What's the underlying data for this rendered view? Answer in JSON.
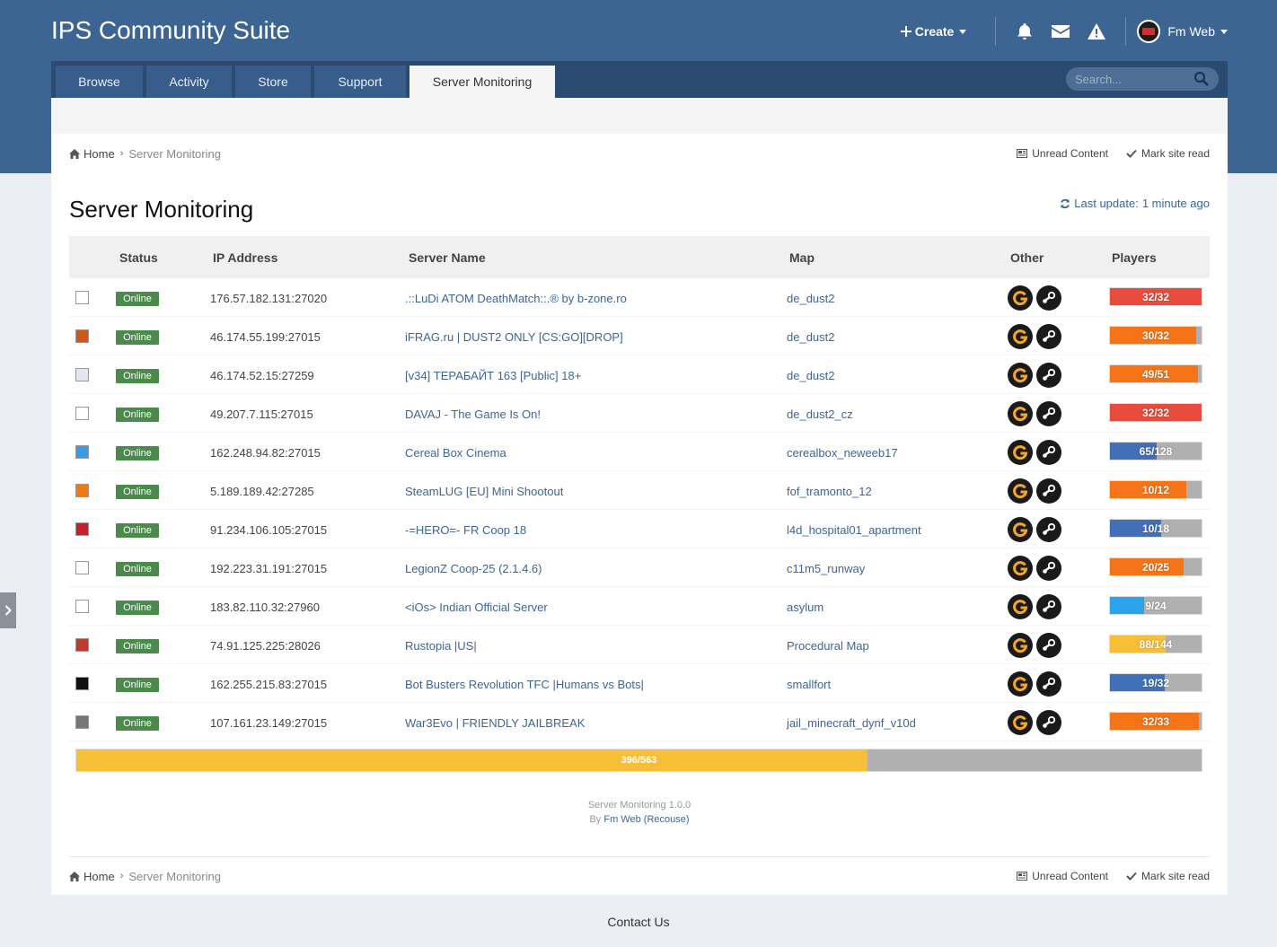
{
  "header": {
    "site_title": "IPS Community Suite",
    "create_label": "Create",
    "user_name": "Fm Web"
  },
  "nav": {
    "tabs": [
      "Browse",
      "Activity",
      "Store",
      "Support",
      "Server Monitoring"
    ],
    "active_tab": "Server Monitoring",
    "search_placeholder": "Search..."
  },
  "breadcrumb": {
    "home": "Home",
    "current": "Server Monitoring",
    "unread_content": "Unread Content",
    "mark_site_read": "Mark site read"
  },
  "page": {
    "title": "Server Monitoring",
    "last_update_label": "Last update:",
    "last_update_value": "1 minute ago"
  },
  "table": {
    "columns": [
      "Status",
      "IP Address",
      "Server Name",
      "Map",
      "Other",
      "Players"
    ],
    "rows": [
      {
        "game_icon": "cs-icon",
        "status": "Online",
        "ip": "176.57.182.131:27020",
        "name": ".::LuDi ATOM DeathMatch::.® by b-zone.ro",
        "map": "de_dust2",
        "players": "32/32",
        "fill": 1.0,
        "color": "#e74c3c"
      },
      {
        "game_icon": "csgo-icon",
        "status": "Online",
        "ip": "46.174.55.199:27015",
        "name": "iFRAG.ru | DUST2 ONLY [CS:GO][DROP]",
        "map": "de_dust2",
        "players": "30/32",
        "fill": 0.9375,
        "color": "#f57418"
      },
      {
        "game_icon": "cs-source-icon",
        "status": "Online",
        "ip": "46.174.52.15:27259",
        "name": "[v34] ТЕРАБАЙТ 163 [Public] 18+",
        "map": "de_dust2",
        "players": "49/51",
        "fill": 0.96,
        "color": "#f57418"
      },
      {
        "game_icon": "cs-icon",
        "status": "Online",
        "ip": "49.207.7.115:27015",
        "name": "DAVAJ - The Game Is On!",
        "map": "de_dust2_cz",
        "players": "32/32",
        "fill": 1.0,
        "color": "#e74c3c"
      },
      {
        "game_icon": "gmod-icon",
        "status": "Online",
        "ip": "162.248.94.82:27015",
        "name": "Cereal Box Cinema",
        "map": "cerealbox_neweeb17",
        "players": "65/128",
        "fill": 0.508,
        "color": "#4170b8"
      },
      {
        "game_icon": "half-life-icon",
        "status": "Online",
        "ip": "5.189.189.42:27285",
        "name": "SteamLUG [EU] Mini Shootout",
        "map": "fof_tramonto_12",
        "players": "10/12",
        "fill": 0.833,
        "color": "#f57418"
      },
      {
        "game_icon": "l4d-icon",
        "status": "Online",
        "ip": "91.234.106.105:27015",
        "name": "-=HERO=- FR Coop 18",
        "map": "l4d_hospital01_apartment",
        "players": "10/18",
        "fill": 0.556,
        "color": "#4170b8"
      },
      {
        "game_icon": "l4d2-icon",
        "status": "Online",
        "ip": "192.223.31.191:27015",
        "name": "LegionZ Coop-25 (2.1.4.6)",
        "map": "c11m5_runway",
        "players": "20/25",
        "fill": 0.8,
        "color": "#f57418"
      },
      {
        "game_icon": "quake-icon",
        "status": "Online",
        "ip": "183.82.110.32:27960",
        "name": "<iOs> Indian Official Server",
        "map": "asylum",
        "players": "9/24",
        "fill": 0.375,
        "color": "#2aa3ea"
      },
      {
        "game_icon": "rust-icon",
        "status": "Online",
        "ip": "74.91.125.225:28026",
        "name": "Rustopia |US|",
        "map": "Procedural Map",
        "players": "88/144",
        "fill": 0.611,
        "color": "#f7be38"
      },
      {
        "game_icon": "tfc-icon",
        "status": "Online",
        "ip": "162.255.215.83:27015",
        "name": "Bot Busters Revolution TFC |Humans vs Bots|",
        "map": "smallfort",
        "players": "19/32",
        "fill": 0.594,
        "color": "#4170b8"
      },
      {
        "game_icon": "tf2-icon",
        "status": "Online",
        "ip": "107.161.23.149:27015",
        "name": "War3Evo | FRIENDLY JAILBREAK",
        "map": "jail_minecraft_dynf_v10d",
        "players": "32/33",
        "fill": 0.97,
        "color": "#f57418"
      }
    ]
  },
  "total": {
    "players": "396/563",
    "fill": 0.703,
    "color": "#f7be38"
  },
  "credit": {
    "line1": "Server Monitoring 1.0.0",
    "by": "By",
    "author": "Fm Web",
    "author_alt": "(Recouse)"
  },
  "footer": {
    "contact": "Contact Us"
  }
}
